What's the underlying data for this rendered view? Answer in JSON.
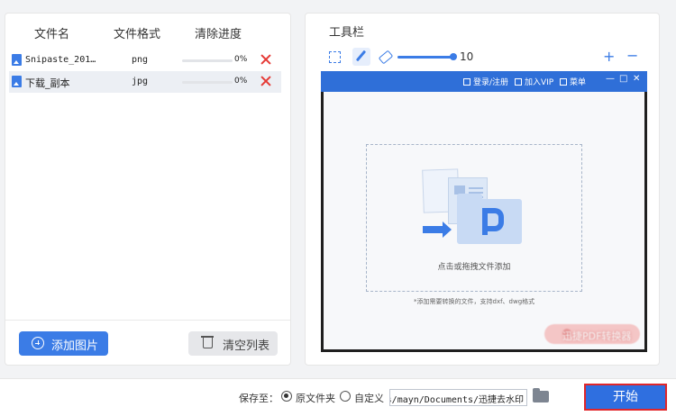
{
  "file_list": {
    "headers": {
      "name": "文件名",
      "format": "文件格式",
      "progress": "清除进度"
    },
    "rows": [
      {
        "name": "Snipaste_201…",
        "format": "png",
        "progress": 0,
        "progress_label": "0%",
        "selected": false
      },
      {
        "name": "下载_副本",
        "format": "jpg",
        "progress": 0,
        "progress_label": "0%",
        "selected": true
      }
    ],
    "add_label": "添加图片",
    "clear_label": "清空列表"
  },
  "toolbar": {
    "title": "工具栏",
    "brush_size": 10,
    "zoom_in": "+",
    "zoom_out": "−"
  },
  "preview": {
    "app_bar": {
      "login": "登录/注册",
      "vip": "加入VIP",
      "menu": "菜单",
      "win_min": "—",
      "win_max": "□",
      "win_close": "✕"
    },
    "drop_text": "点击或拖拽文件添加",
    "hint_text": "*添加需要转换的文件，支持dxf、dwg格式",
    "watermark": "迅捷PDF转换器"
  },
  "save": {
    "label": "保存至：",
    "option_orig": "原文件夹",
    "option_custom": "自定义",
    "selected": "orig",
    "path": "ers/mayn/Documents/迅捷去水印"
  },
  "start_label": "开始",
  "colors": {
    "accent": "#3b7ce6",
    "delete": "#e53935",
    "highlight_border": "#e0262a"
  }
}
